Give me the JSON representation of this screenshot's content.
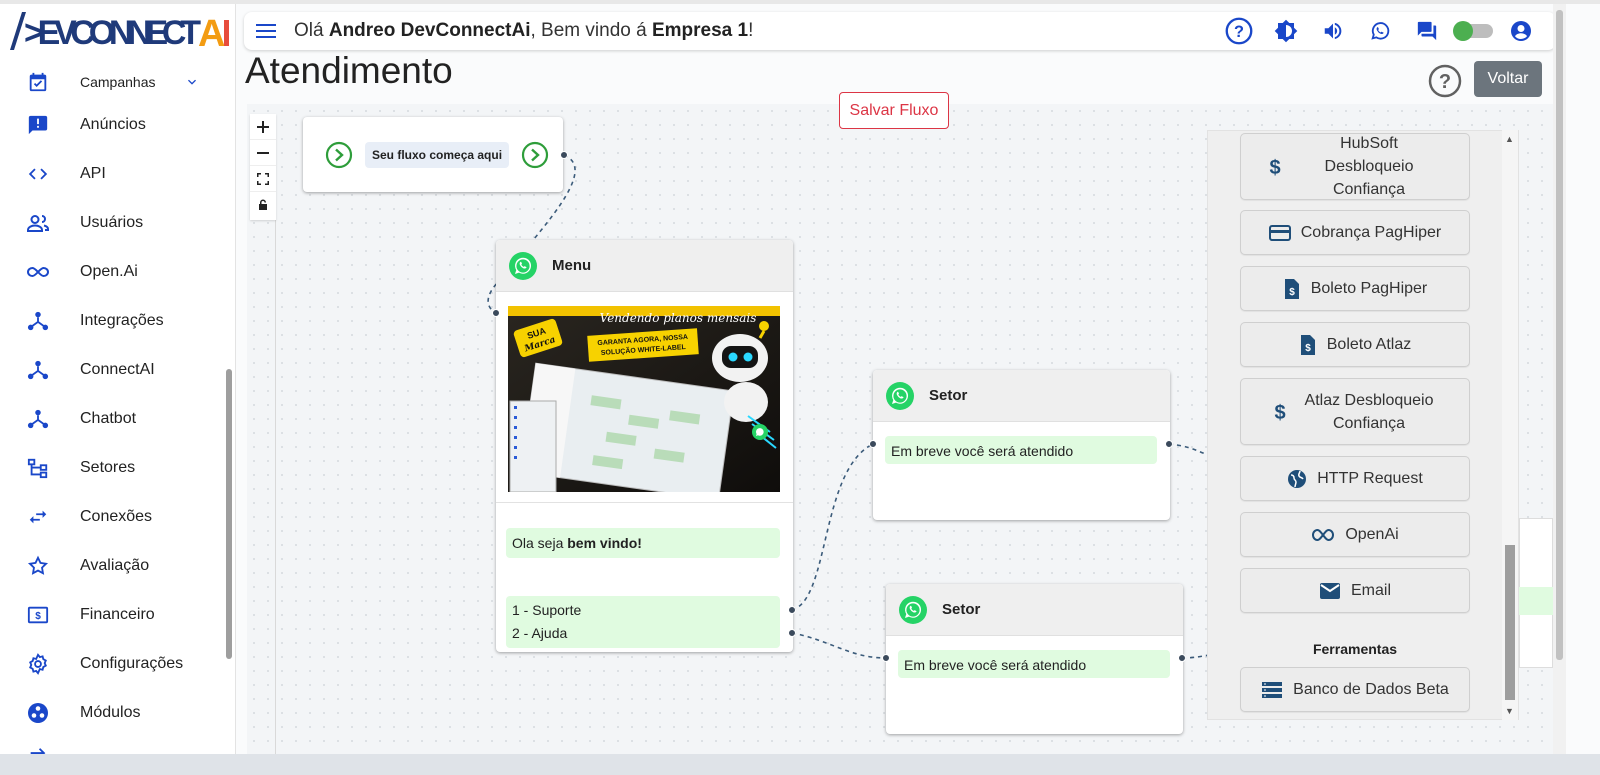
{
  "app": {
    "logo_text": "DEVCONNECTAi"
  },
  "header": {
    "greeting_prefix": "Olá ",
    "user_name": "Andreo DevConnectAi",
    "greeting_mid": ", Bem vindo á ",
    "company": "Empresa 1",
    "greeting_suffix": "!"
  },
  "sidebar": {
    "items": [
      {
        "label": "Campanhas",
        "icon": "calendar-check-icon"
      },
      {
        "label": "Anúncios",
        "icon": "announcement-icon"
      },
      {
        "label": "API",
        "icon": "code-icon"
      },
      {
        "label": "Usuários",
        "icon": "people-icon"
      },
      {
        "label": "Open.Ai",
        "icon": "infinity-icon"
      },
      {
        "label": "Integrações",
        "icon": "hub-icon"
      },
      {
        "label": "ConnectAI",
        "icon": "hub-icon"
      },
      {
        "label": "Chatbot",
        "icon": "hub-icon"
      },
      {
        "label": "Setores",
        "icon": "tree-icon"
      },
      {
        "label": "Conexões",
        "icon": "swap-icon"
      },
      {
        "label": "Avaliação",
        "icon": "star-icon"
      },
      {
        "label": "Financeiro",
        "icon": "money-icon"
      },
      {
        "label": "Configurações",
        "icon": "gear-icon"
      },
      {
        "label": "Módulos",
        "icon": "modules-icon"
      }
    ]
  },
  "page": {
    "title": "Atendimento",
    "back_button": "Voltar",
    "save_button": "Salvar Fluxo"
  },
  "flow": {
    "start_label": "Seu fluxo começa aqui",
    "menu": {
      "title": "Menu",
      "message_prefix": "Ola seja ",
      "message_bold": "bem vindo!",
      "option1": "1 - Suporte",
      "option2": "2 - Ajuda",
      "image_text_top": "Vendendo planos mensais",
      "image_badge": "SUA Marca",
      "image_banner": "GARANTA AGORA, NOSSA SOLUÇÃO WHITE-LABEL",
      "image_banner_line1": "GARANTA AGORA, NOSSA",
      "image_banner_line2": "SOLUÇÃO WHITE-LABEL"
    },
    "setor1": {
      "title": "Setor",
      "message": "Em breve você será atendido"
    },
    "setor2": {
      "title": "Setor",
      "message": "Em breve você será atendido"
    }
  },
  "panel": {
    "buttons": [
      {
        "label": "HubSoft Desbloqueio Confiança",
        "icon": "dollar-icon"
      },
      {
        "label": "Cobrança PagHiper",
        "icon": "credit-card-icon"
      },
      {
        "label": "Boleto PagHiper",
        "icon": "invoice-icon"
      },
      {
        "label": "Boleto Atlaz",
        "icon": "invoice-icon"
      },
      {
        "label": "Atlaz Desbloqueio Confiança",
        "icon": "dollar-icon"
      },
      {
        "label": "HTTP Request",
        "icon": "globe-icon"
      },
      {
        "label": "OpenAi",
        "icon": "infinity-icon"
      },
      {
        "label": "Email",
        "icon": "mail-icon"
      }
    ],
    "tools_heading": "Ferramentas",
    "tools": [
      {
        "label": "Banco de Dados Beta",
        "icon": "database-icon"
      }
    ]
  },
  "colors": {
    "accent": "#1a47c9",
    "whatsapp": "#25d366",
    "message_bg": "#e0fbe0",
    "danger": "#dc3545"
  }
}
